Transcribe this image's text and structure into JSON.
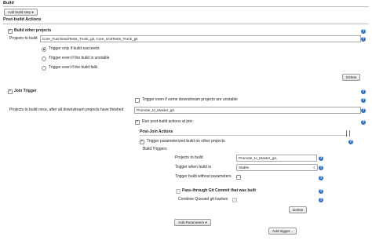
{
  "section": {
    "build": "Build",
    "add_build_step": "Add build step ▾",
    "post_build": "Post-build Actions"
  },
  "build_other": {
    "title": "Build other projects",
    "projects_label": "Projects to build",
    "projects_value": "Core_FunctionalTests_Trunk_git, Core_UnitTests_Trunk_git",
    "radio": [
      "Trigger only if build succeeds",
      "Trigger even if the build is unstable",
      "Trigger even if the build fails"
    ],
    "delete": "Delete"
  },
  "join": {
    "title": "Join Trigger",
    "unstable_label": "Trigger even if some downstream projects are unstable",
    "projects_label": "Projects to build once, after all downstream projects have finished",
    "projects_value": "Promote_to_Master_git",
    "run_post_build": "Run post-build actions at join"
  },
  "post_join": {
    "title": "Post-Join Actions",
    "trigger_param": "Trigger parameterized build on other projects",
    "build_triggers": "Build Triggers",
    "projects_label": "Projects to build",
    "projects_value": "Promote_to_Master_git,",
    "when_label": "Trigger when build is",
    "when_value": "Stable",
    "without_params": "Trigger build without parameters",
    "pass_through": "Pass-through Git Commit that was built",
    "combine_queued": "Combine Queued git hashes",
    "delete": "Delete",
    "add_parameters": "Add Parameters ▾",
    "add_trigger": "Add trigger..."
  },
  "icons": {
    "help": "?"
  }
}
